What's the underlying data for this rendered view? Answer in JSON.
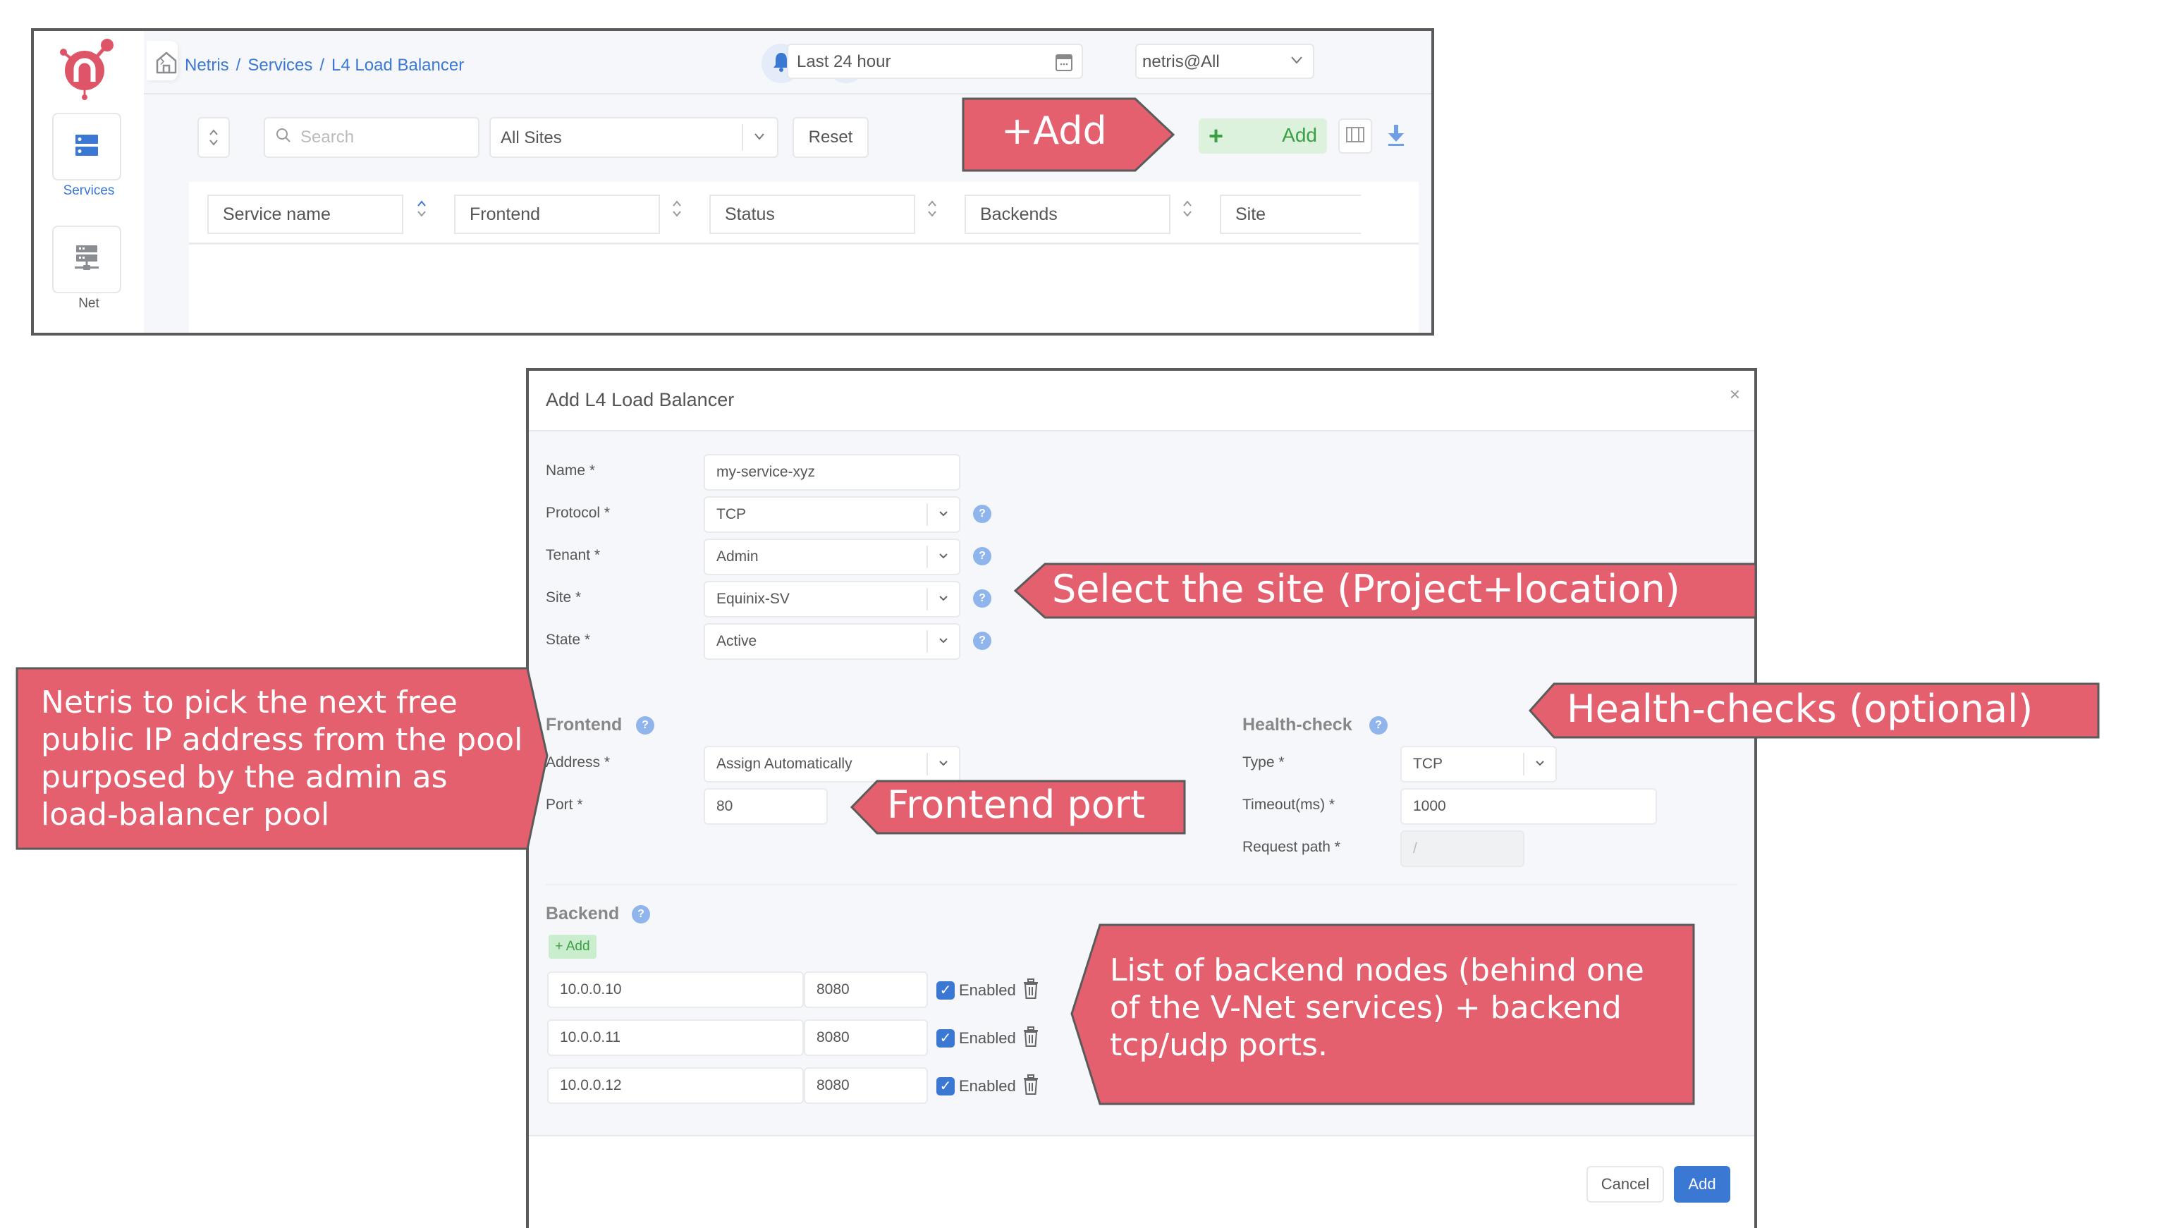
{
  "app": {
    "sidebar": {
      "items": [
        {
          "label": "Services",
          "icon": "server-stack-icon",
          "active": true
        },
        {
          "label": "Net",
          "icon": "network-server-icon",
          "active": false
        }
      ],
      "collapse_icon": "chevron-right-icon"
    },
    "header": {
      "breadcrumb": [
        "Netris",
        "Services",
        "L4 Load Balancer"
      ],
      "breadcrumb_separator": "/",
      "date_range": "Last 24 hour",
      "tenant_select": "netris@All"
    },
    "toolbar": {
      "search_placeholder": "Search",
      "site_filter": "All Sites",
      "reset_label": "Reset",
      "add_label": "Add",
      "add_plus": "+"
    },
    "table": {
      "columns": [
        "Service name",
        "Frontend",
        "Status",
        "Backends",
        "Site"
      ]
    }
  },
  "modal": {
    "title": "Add L4 Load Balancer",
    "close_label": "×",
    "fields": {
      "name": {
        "label": "Name *",
        "value": "my-service-xyz"
      },
      "protocol": {
        "label": "Protocol *",
        "value": "TCP"
      },
      "tenant": {
        "label": "Tenant *",
        "value": "Admin"
      },
      "site": {
        "label": "Site *",
        "value": "Equinix-SV"
      },
      "state": {
        "label": "State *",
        "value": "Active"
      }
    },
    "frontend": {
      "title": "Frontend",
      "address": {
        "label": "Address *",
        "value": "Assign Automatically"
      },
      "port": {
        "label": "Port *",
        "value": "80"
      }
    },
    "health_check": {
      "title": "Health-check",
      "type": {
        "label": "Type *",
        "value": "TCP"
      },
      "timeout": {
        "label": "Timeout(ms) *",
        "value": "1000"
      },
      "request_path": {
        "label": "Request path *",
        "placeholder": "/"
      }
    },
    "backend": {
      "title": "Backend",
      "add_label": "+ Add",
      "rows": [
        {
          "ip": "10.0.0.10",
          "port": "8080",
          "enabled": true,
          "enabled_label": "Enabled"
        },
        {
          "ip": "10.0.0.11",
          "port": "8080",
          "enabled": true,
          "enabled_label": "Enabled"
        },
        {
          "ip": "10.0.0.12",
          "port": "8080",
          "enabled": true,
          "enabled_label": "Enabled"
        }
      ]
    },
    "footer": {
      "cancel_label": "Cancel",
      "submit_label": "Add"
    },
    "help_icon": "?"
  },
  "annotations": {
    "add": "+Add",
    "site": "Select the site (Project+location)",
    "health": "Health-checks (optional)",
    "frontend_port": "Frontend port",
    "frontend_ip": "Netris to pick the next free\npublic IP address from the pool\npurposed by the admin as\nload-balancer pool",
    "backends": "List of backend nodes (behind one\nof the V-Net services) + backend\ntcp/udp ports."
  },
  "colors": {
    "accent_blue": "#3a78d4",
    "add_green": "#3aa043",
    "add_green_bg": "#dcf2dd",
    "annotation_red": "#e4606f",
    "logo_red": "#dd5566"
  }
}
